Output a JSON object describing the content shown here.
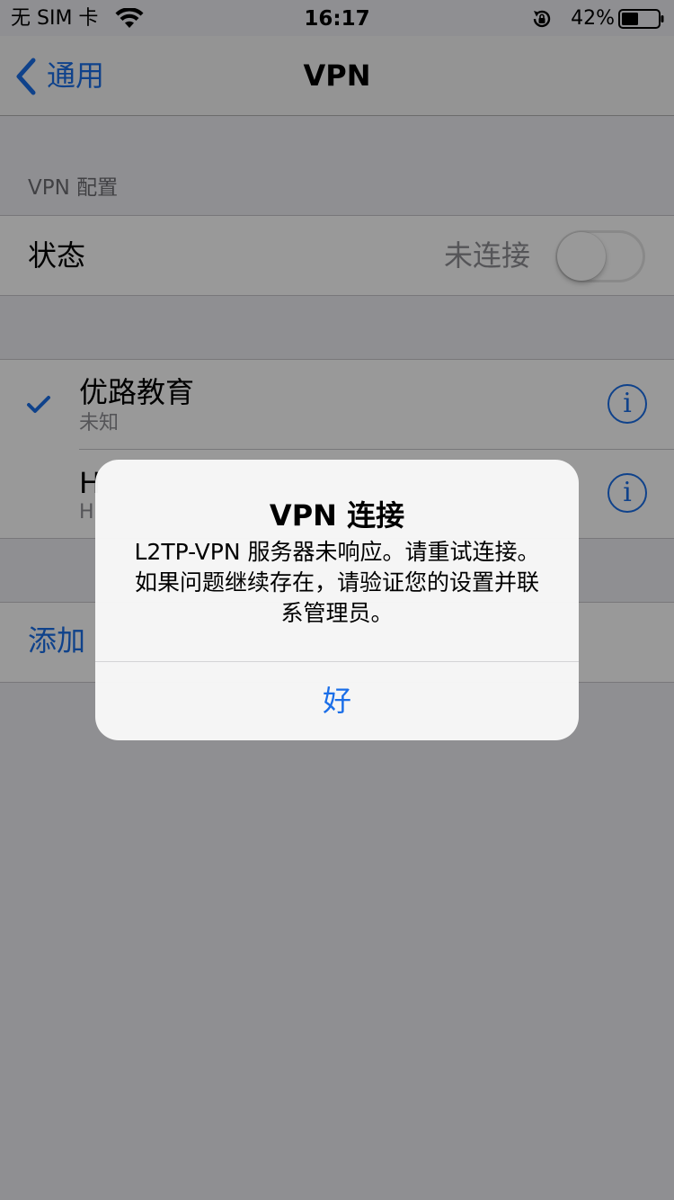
{
  "status_bar": {
    "carrier": "无 SIM 卡",
    "time": "16:17",
    "battery_percent": "42%"
  },
  "nav": {
    "back_label": "通用",
    "title": "VPN"
  },
  "config_section": {
    "header": "VPN 配置",
    "status_label": "状态",
    "status_value": "未连接",
    "toggle_on": false
  },
  "vpn_list": [
    {
      "name": "优路教育",
      "subtitle": "未知",
      "selected": true
    },
    {
      "name": "H",
      "subtitle": "H",
      "selected": false
    }
  ],
  "add_label": "添加",
  "alert": {
    "title": "VPN 连接",
    "message": "L2TP-VPN 服务器未响应。请重试连接。如果问题继续存在，请验证您的设置并联系管理员。",
    "button": "好"
  },
  "colors": {
    "accent": "#1a6ee8",
    "background": "#efeff4",
    "secondary_text": "#8e8e93"
  },
  "icons": {
    "wifi": "wifi-icon",
    "orientation_lock": "orientation-lock-icon",
    "battery": "battery-icon",
    "back": "chevron-left-icon",
    "check": "checkmark-icon",
    "info": "info-icon"
  }
}
